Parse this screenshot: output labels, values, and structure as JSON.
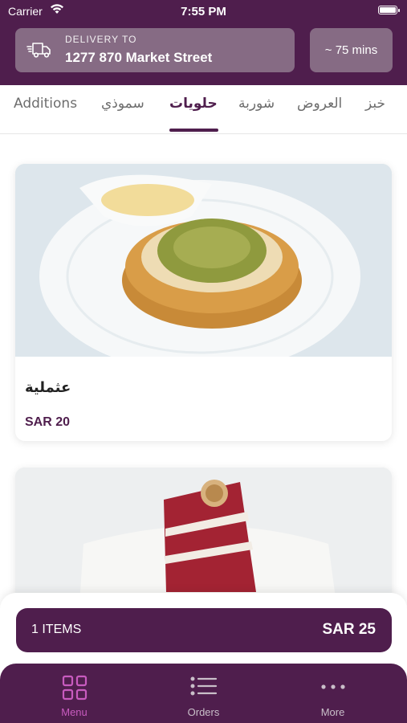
{
  "status": {
    "carrier": "Carrier",
    "time": "7:55 PM"
  },
  "header": {
    "delivery_label": "DELIVERY TO",
    "address": "1277 870 Market Street",
    "eta": "~ 75 mins"
  },
  "tabs": [
    {
      "label": "Additions",
      "active": false
    },
    {
      "label": "سموذي",
      "active": false
    },
    {
      "label": "حلويات",
      "active": true
    },
    {
      "label": "شوربة",
      "active": false
    },
    {
      "label": "العروض",
      "active": false
    },
    {
      "label": "خبز",
      "active": false
    }
  ],
  "items": [
    {
      "name": "عثملية",
      "price": "SAR 20"
    },
    {
      "name": "",
      "price": ""
    }
  ],
  "cart": {
    "items": "1 ITEMS",
    "total": "SAR 25"
  },
  "tabbar": [
    {
      "label": "Menu",
      "icon": "menu-grid-icon",
      "active": true
    },
    {
      "label": "Orders",
      "icon": "list-icon",
      "active": false
    },
    {
      "label": "More",
      "icon": "more-dots-icon",
      "active": false
    }
  ],
  "colors": {
    "primary": "#4f1e4d",
    "accent": "#c85bbf",
    "header_chip": "#866b84"
  }
}
